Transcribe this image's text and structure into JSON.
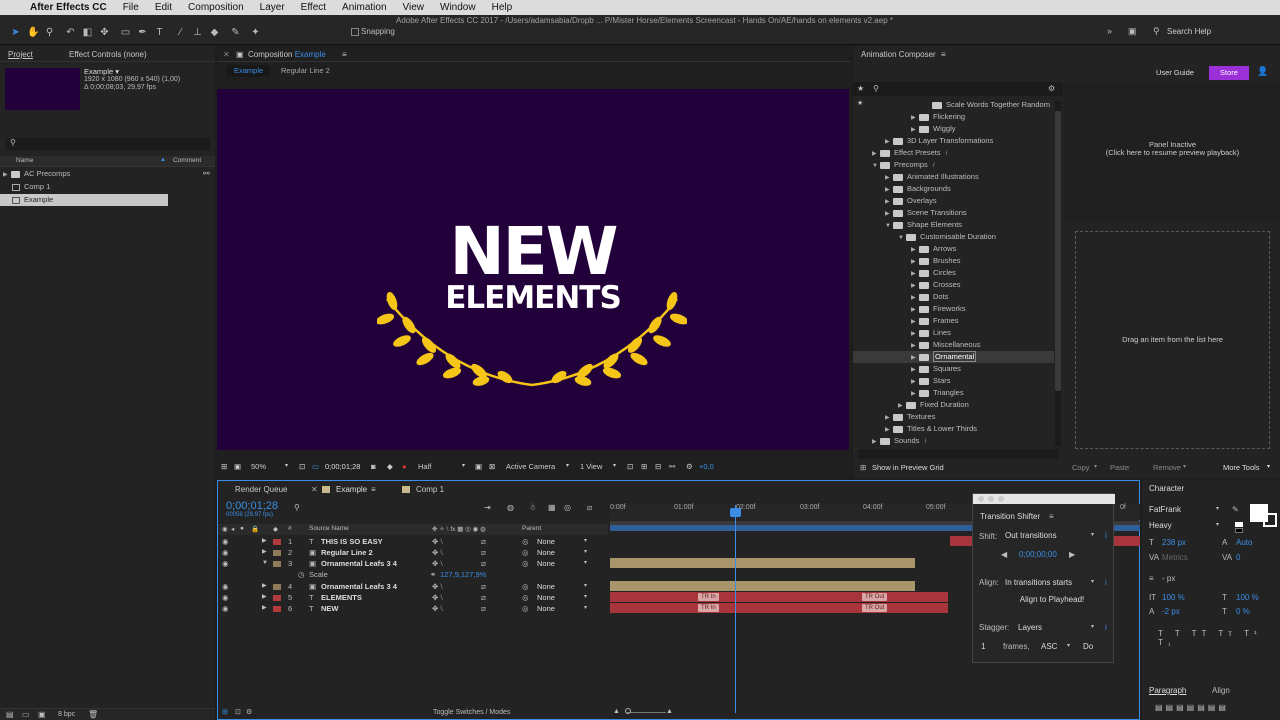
{
  "menubar": {
    "app_name": "After Effects CC",
    "items": [
      "File",
      "Edit",
      "Composition",
      "Layer",
      "Effect",
      "Animation",
      "View",
      "Window",
      "Help"
    ]
  },
  "window_title": "Adobe After Effects CC 2017 - /Users/adamsabia/Dropb ... P/Mister Horse/Elements Screencast - Hands On/AE/hands on elements v2.aep *",
  "toolbar": {
    "snapping_label": "Snapping",
    "search_placeholder": "Search Help"
  },
  "project": {
    "tab_project": "Project",
    "tab_effect_controls": "Effect Controls (none)",
    "item_name": "Example ▾",
    "item_size": "1920 x 1080  (960 x 540) (1,00)",
    "item_duration": "Δ 0;00;08;03, 29,97 fps",
    "col_name": "Name",
    "col_comment": "Comment",
    "items": [
      "AC Precomps",
      "Comp 1",
      "Example"
    ],
    "bpc": "8 bpc"
  },
  "composition": {
    "tab_prefix": "Composition",
    "tab_name": "Example",
    "sub_tabs": [
      "Example",
      "Regular Line 2"
    ],
    "headline_line1": "NEW",
    "headline_line2": "ELEMENTS",
    "zoom": "50%",
    "timecode": "0;00;01;28",
    "resolution": "Half",
    "camera": "Active Camera",
    "view": "1 View",
    "exposure": "+0,0"
  },
  "animation_composer": {
    "title": "Animation Composer",
    "user_guide": "User Guide",
    "store": "Store",
    "tree": [
      {
        "label": "Scale Words Together Random",
        "depth": 5,
        "icon": "file",
        "expanded": null
      },
      {
        "label": "Flickering",
        "depth": 4,
        "icon": "folder",
        "expanded": false
      },
      {
        "label": "Wiggly",
        "depth": 4,
        "icon": "folder",
        "expanded": false
      },
      {
        "label": "3D Layer Transformations",
        "depth": 2,
        "icon": "folder",
        "expanded": false
      },
      {
        "label": "Effect Presets",
        "depth": 1,
        "icon": "folder",
        "expanded": false,
        "info": "i"
      },
      {
        "label": "Precomps",
        "depth": 1,
        "icon": "folder",
        "expanded": true,
        "info": "i"
      },
      {
        "label": "Animated Illustrations",
        "depth": 2,
        "icon": "folder",
        "expanded": false
      },
      {
        "label": "Backgrounds",
        "depth": 2,
        "icon": "folder",
        "expanded": false
      },
      {
        "label": "Overlays",
        "depth": 2,
        "icon": "folder",
        "expanded": false
      },
      {
        "label": "Scene Transitions",
        "depth": 2,
        "icon": "folder",
        "expanded": false
      },
      {
        "label": "Shape Elements",
        "depth": 2,
        "icon": "folder",
        "expanded": true
      },
      {
        "label": "Customisable Duration",
        "depth": 3,
        "icon": "folder",
        "expanded": true
      },
      {
        "label": "Arrows",
        "depth": 4,
        "icon": "folder",
        "expanded": false
      },
      {
        "label": "Brushes",
        "depth": 4,
        "icon": "folder",
        "expanded": false
      },
      {
        "label": "Circles",
        "depth": 4,
        "icon": "folder",
        "expanded": false
      },
      {
        "label": "Crosses",
        "depth": 4,
        "icon": "folder",
        "expanded": false
      },
      {
        "label": "Dots",
        "depth": 4,
        "icon": "folder",
        "expanded": false
      },
      {
        "label": "Fireworks",
        "depth": 4,
        "icon": "folder",
        "expanded": false
      },
      {
        "label": "Frames",
        "depth": 4,
        "icon": "folder",
        "expanded": false
      },
      {
        "label": "Lines",
        "depth": 4,
        "icon": "folder",
        "expanded": false
      },
      {
        "label": "Miscellaneous",
        "depth": 4,
        "icon": "folder",
        "expanded": false
      },
      {
        "label": "Ornamental",
        "depth": 4,
        "icon": "folder",
        "expanded": false,
        "selected": true
      },
      {
        "label": "Squares",
        "depth": 4,
        "icon": "folder",
        "expanded": false
      },
      {
        "label": "Stars",
        "depth": 4,
        "icon": "folder",
        "expanded": false
      },
      {
        "label": "Triangles",
        "depth": 4,
        "icon": "folder",
        "expanded": false
      },
      {
        "label": "Fixed Duration",
        "depth": 3,
        "icon": "folder",
        "expanded": false
      },
      {
        "label": "Textures",
        "depth": 2,
        "icon": "folder",
        "expanded": false
      },
      {
        "label": "Titles & Lower Thirds",
        "depth": 2,
        "icon": "folder",
        "expanded": false
      },
      {
        "label": "Sounds",
        "depth": 1,
        "icon": "folder",
        "expanded": false,
        "info": "i"
      }
    ],
    "panel_inactive": "Panel Inactive",
    "resume_hint": "(Click here to resume preview playback)",
    "drag_hint": "Drag an item from the list here",
    "show_in_preview": "Show in Preview Grid",
    "copy": "Copy",
    "paste": "Paste",
    "remove": "Remove",
    "more_tools": "More Tools"
  },
  "timeline": {
    "tabs": [
      "Render Queue",
      "Example",
      "Comp 1"
    ],
    "timecode": "0;00;01;28",
    "frame_info": "00058 (29,97 fps)",
    "col_source": "Source Name",
    "col_parent": "Parent",
    "ruler": [
      "0:00f",
      "01:00f",
      "02:00f",
      "03:00f",
      "04:00f",
      "05:00f",
      "0f"
    ],
    "layers": [
      {
        "num": "1",
        "type": "T",
        "name": "THIS IS SO EASY",
        "parent": "None",
        "label_color": "#b33a3a"
      },
      {
        "num": "2",
        "type": "▣",
        "name": "Regular Line 2",
        "parent": "None",
        "label_color": "#8f7a5a"
      },
      {
        "num": "3",
        "type": "▣",
        "name": "Ornamental Leafs 3 4",
        "parent": "None",
        "label_color": "#8f7a5a"
      },
      {
        "num": "4",
        "type": "▣",
        "name": "Ornamental Leafs 3 4",
        "parent": "None",
        "label_color": "#8f7a5a"
      },
      {
        "num": "5",
        "type": "T",
        "name": "ELEMENTS",
        "parent": "None",
        "label_color": "#b33a3a"
      },
      {
        "num": "6",
        "type": "T",
        "name": "NEW",
        "parent": "None",
        "label_color": "#b33a3a"
      }
    ],
    "scale_prop": "Scale",
    "scale_value": "127,9,127,9%",
    "kf_in": "TR In",
    "kf_out": "TR Out",
    "toggle_label": "Toggle Switches / Modes"
  },
  "transition_shifter": {
    "title": "Transition Shifter",
    "shift_label": "Shift:",
    "shift_value": "Out transitions",
    "time_value": "0;00;00;00",
    "align_label": "Align:",
    "align_value": "In transitions starts",
    "align_button": "Align to Playhead!",
    "stagger_label": "Stagger:",
    "stagger_value": "Layers",
    "frames_count": "1",
    "frames_label": "frames,",
    "order_value": "ASC",
    "do_button": "Do"
  },
  "character": {
    "title": "Character",
    "font": "FatFrank",
    "style": "Heavy",
    "size": "238 px",
    "leading": "Auto",
    "kerning": "Metrics",
    "tracking": "0",
    "stroke": "- px",
    "v_scale": "100 %",
    "h_scale": "100 %",
    "baseline": "-2 px",
    "tsume": "0 %",
    "paragraph": "Paragraph",
    "align": "Align"
  },
  "colors": {
    "comp_bg": "#22003a",
    "laurel": "#f5c518",
    "accent_blue": "#3a8ee6",
    "store": "#9b30d9",
    "layer_red": "#a8343c",
    "layer_tan": "#a8956c"
  }
}
